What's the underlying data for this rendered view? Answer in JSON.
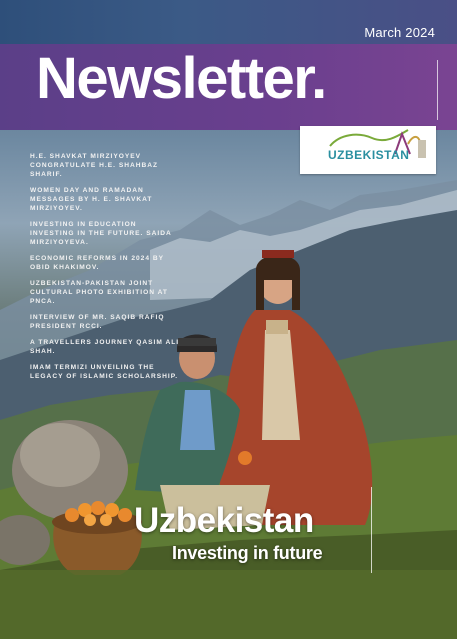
{
  "header": {
    "date": "March 2024",
    "title": "Newsletter."
  },
  "logo": {
    "name": "UZBEKISTAN",
    "icon": "uzbekistan-tourism-logo-icon"
  },
  "headlines": [
    "H.E. SHAVKAT MIRZIYOYEV CONGRATULATE H.E. SHAHBAZ SHARIF.",
    "WOMEN DAY AND RAMADAN MESSAGES BY H. E. SHAVKAT MIRZIYOYEV.",
    "INVESTING IN EDUCATION INVESTING IN THE FUTURE. SAIDA MIRZIYOYEVA.",
    "ECONOMIC REFORMS IN 2024 BY OBID KHAKIMOV.",
    "UZBEKISTAN-PAKISTAN JOINT CULTURAL PHOTO EXHIBITION AT PNCA.",
    "INTERVIEW OF MR. SAQIB RAFIQ PRESIDENT RCCI.",
    "A TRAVELLERS JOURNEY QASIM ALI SHAH.",
    "IMAM TERMIZI UNVEILING THE LEGACY OF ISLAMIC SCHOLARSHIP."
  ],
  "feature": {
    "title": "Uzbekistan",
    "subtitle": "Investing in future"
  },
  "colors": {
    "top_band": "#3b5a86",
    "title_band": "#6a3f8e",
    "logo_teal": "#2a8fa0",
    "text": "#ffffff"
  }
}
